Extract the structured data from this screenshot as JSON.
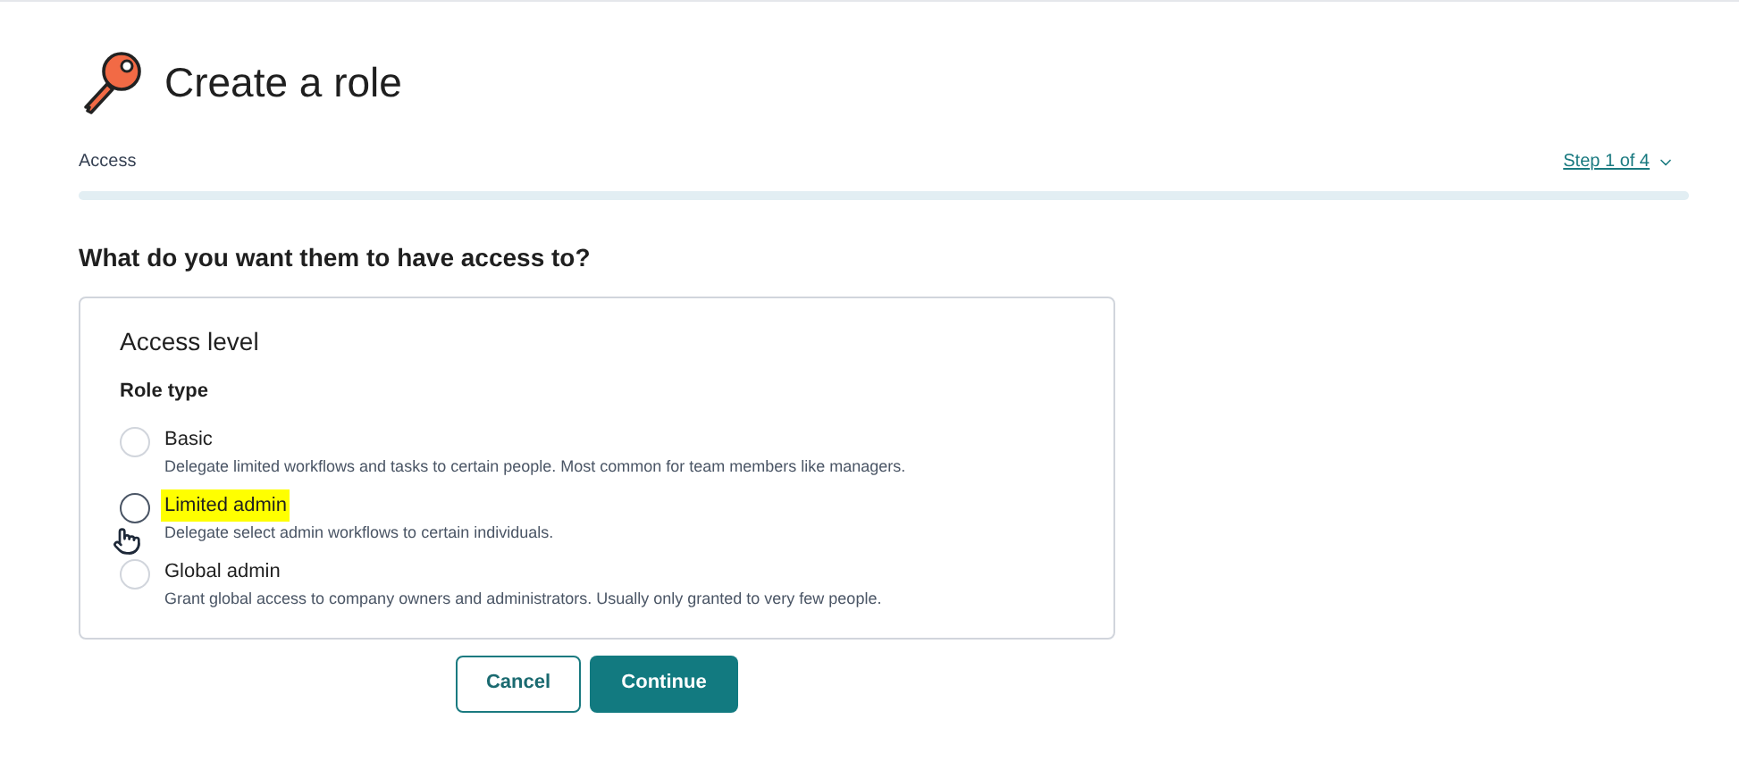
{
  "title": "Create a role",
  "step": {
    "label": "Access",
    "link": "Step 1 of 4"
  },
  "question": "What do you want them to have access to?",
  "card": {
    "title": "Access level",
    "group_label": "Role type",
    "options": [
      {
        "label": "Basic",
        "description": "Delegate limited workflows and tasks to certain people. Most common for team members like managers.",
        "selected": false,
        "highlighted": false
      },
      {
        "label": "Limited admin",
        "description": "Delegate select admin workflows to certain individuals.",
        "selected": false,
        "highlighted": true
      },
      {
        "label": "Global admin",
        "description": "Grant global access to company owners and administrators. Usually only granted to very few people.",
        "selected": false,
        "highlighted": false
      }
    ]
  },
  "buttons": {
    "cancel": "Cancel",
    "continue": "Continue"
  }
}
